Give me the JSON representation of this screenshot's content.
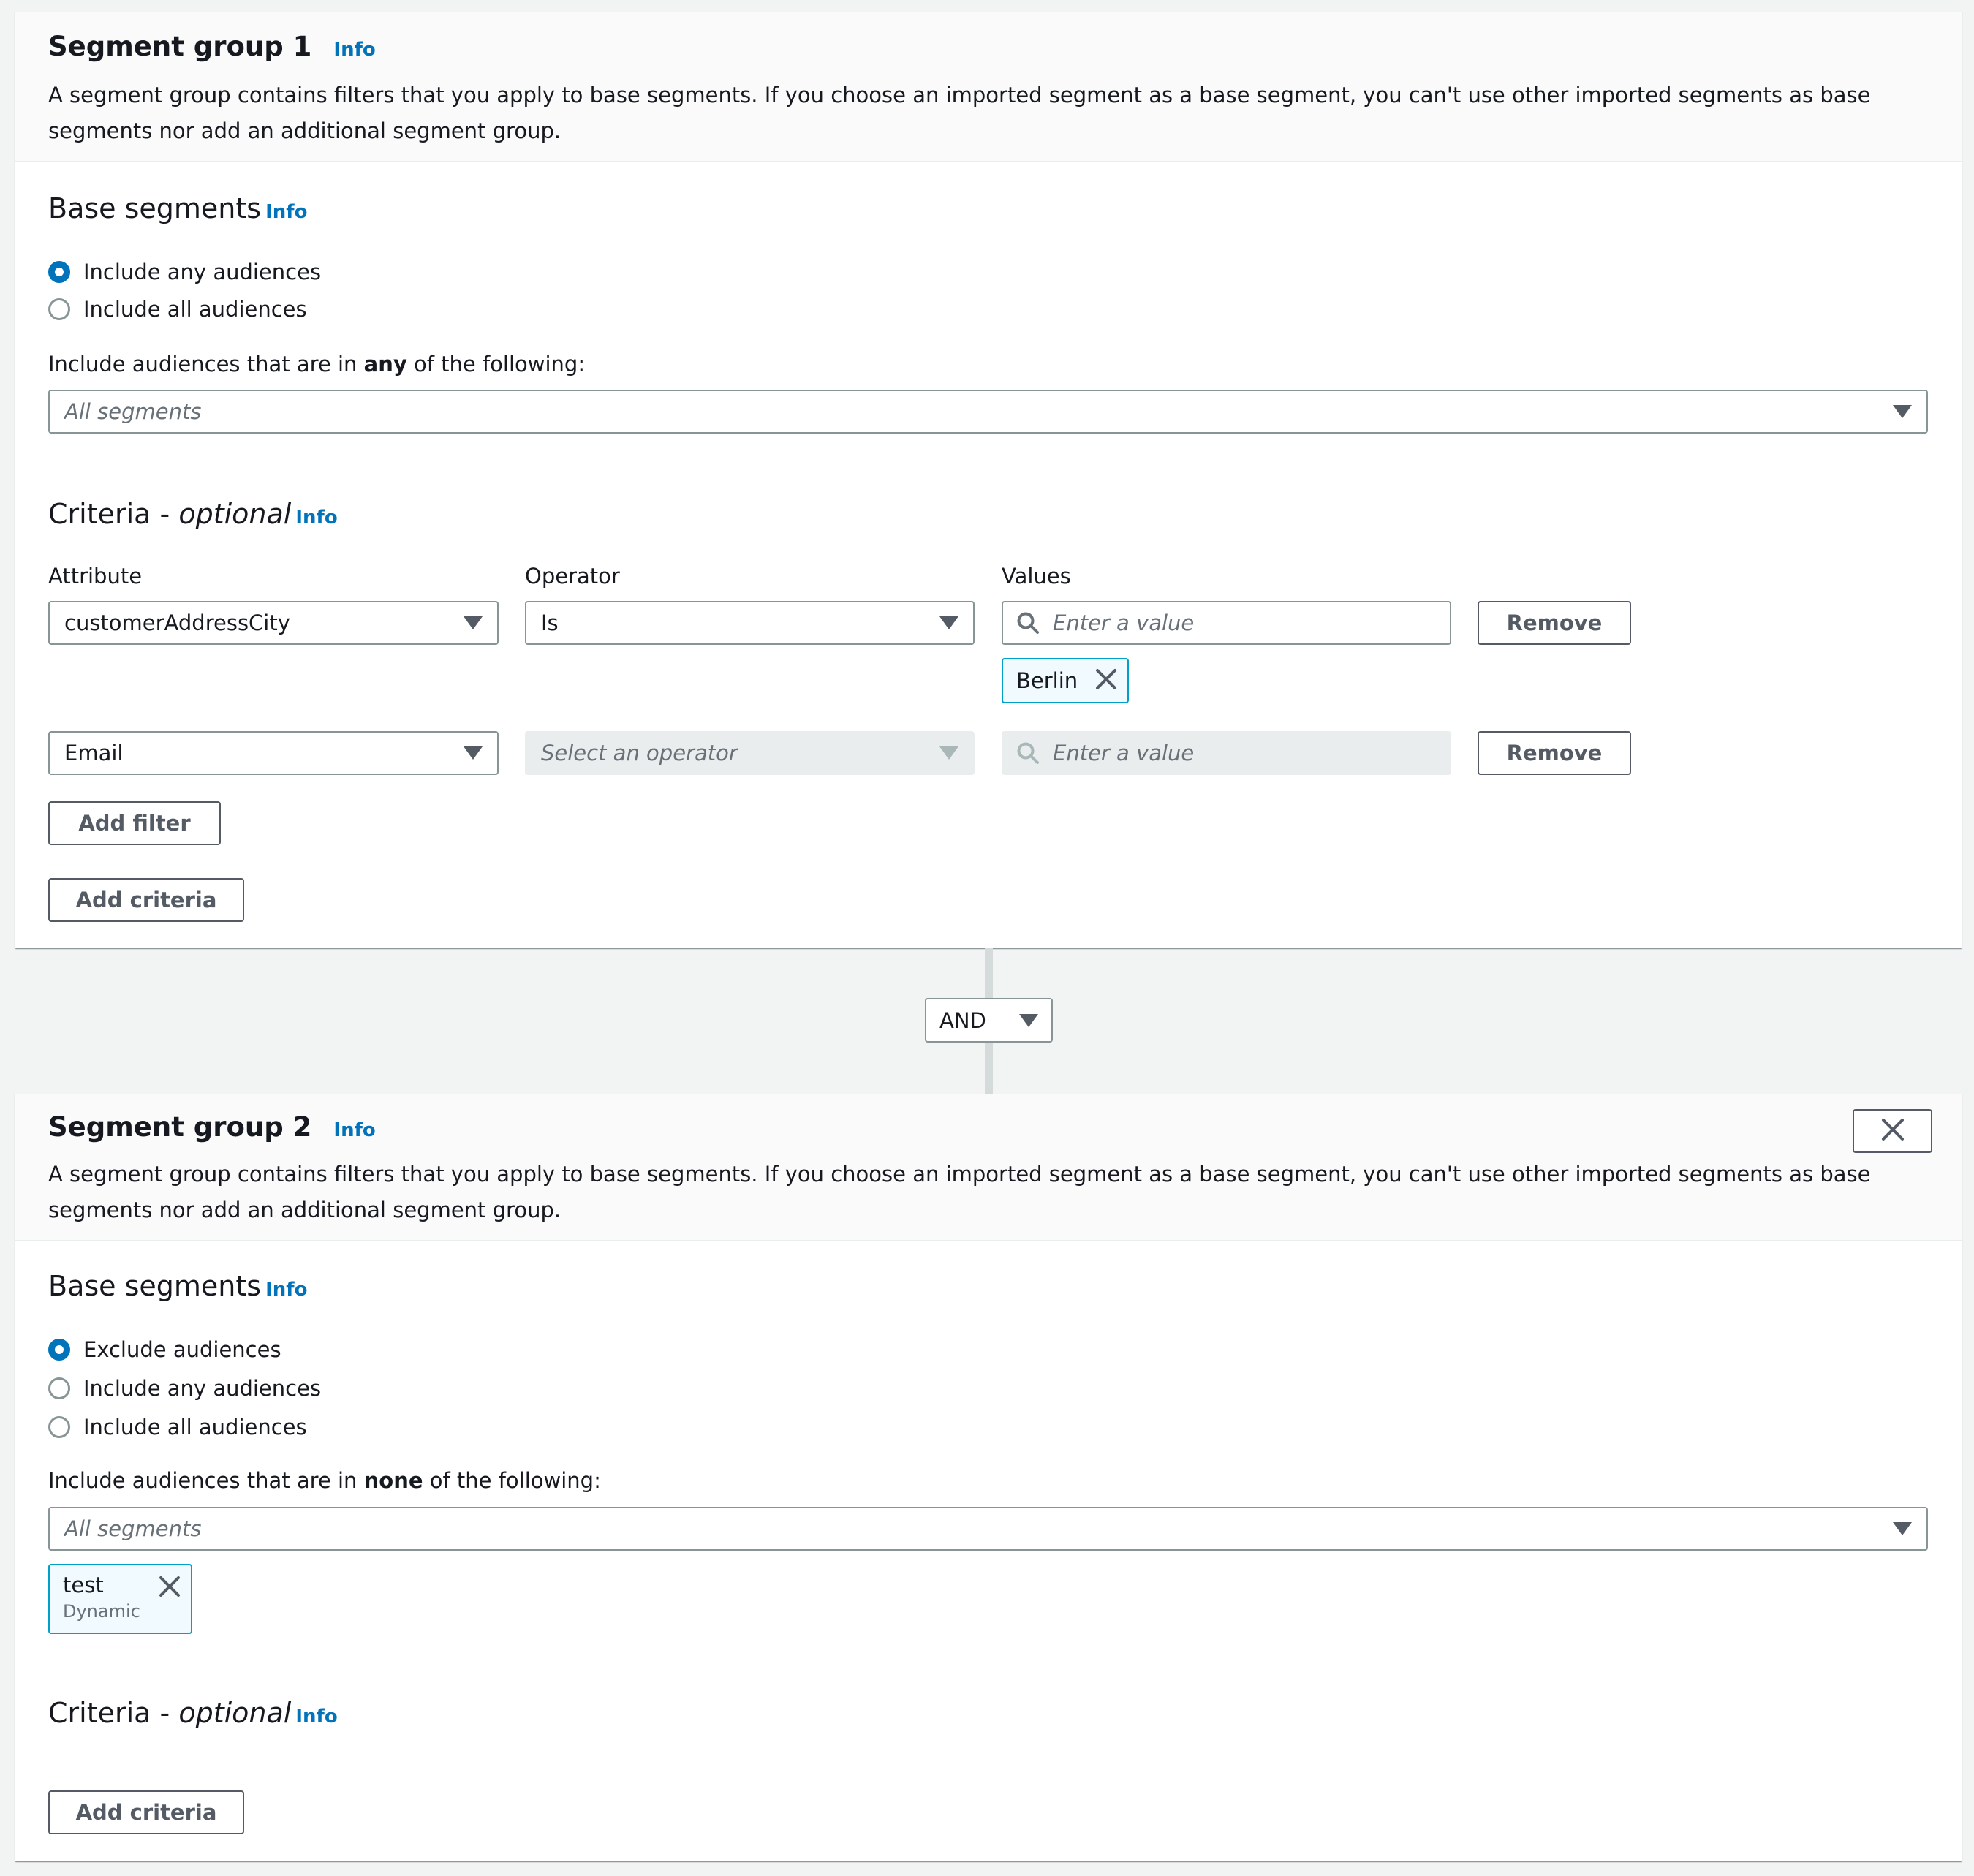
{
  "groups": [
    {
      "title": "Segment group 1",
      "info": "Info",
      "description": "A segment group contains filters that you apply to base segments. If you choose an imported segment as a base segment, you can't use other imported segments as base segments nor add an additional segment group.",
      "base_segments": {
        "heading": "Base segments",
        "info": "Info",
        "radios": [
          {
            "label": "Include any audiences",
            "checked": true
          },
          {
            "label": "Include all audiences",
            "checked": false
          }
        ],
        "field_label_prefix": "Include audiences that are in ",
        "field_label_bold": "any",
        "field_label_suffix": " of the following:",
        "segments_placeholder": "All segments"
      },
      "criteria": {
        "heading": "Criteria - ",
        "heading_italic": "optional",
        "info": "Info",
        "columns": {
          "attribute": "Attribute",
          "operator": "Operator",
          "values": "Values"
        },
        "filters": [
          {
            "attribute": "customerAddressCity",
            "operator": "Is",
            "operator_disabled": false,
            "values_placeholder": "Enter a value",
            "values_disabled": false,
            "tokens": [
              "Berlin"
            ],
            "remove_label": "Remove"
          },
          {
            "attribute": "Email",
            "operator": "Select an operator",
            "operator_disabled": true,
            "values_placeholder": "Enter a value",
            "values_disabled": true,
            "tokens": [],
            "remove_label": "Remove"
          }
        ],
        "add_filter_label": "Add filter",
        "add_criteria_label": "Add criteria"
      }
    },
    {
      "title": "Segment group 2",
      "info": "Info",
      "description": "A segment group contains filters that you apply to base segments. If you choose an imported segment as a base segment, you can't use other imported segments as base segments nor add an additional segment group.",
      "base_segments": {
        "heading": "Base segments",
        "info": "Info",
        "radios": [
          {
            "label": "Exclude audiences",
            "checked": true
          },
          {
            "label": "Include any audiences",
            "checked": false
          },
          {
            "label": "Include all audiences",
            "checked": false
          }
        ],
        "field_label_prefix": "Include audiences that are in ",
        "field_label_bold": "none",
        "field_label_suffix": " of the following:",
        "segments_placeholder": "All segments",
        "selected_segments": [
          {
            "name": "test",
            "type": "Dynamic"
          }
        ]
      },
      "criteria": {
        "heading": "Criteria - ",
        "heading_italic": "optional",
        "info": "Info",
        "add_criteria_label": "Add criteria"
      }
    }
  ],
  "connector": {
    "value": "AND"
  },
  "colors": {
    "accent": "#0073bb",
    "token_border": "#00a1c9",
    "token_bg": "#f1faff",
    "page_bg": "#f2f3f3"
  }
}
